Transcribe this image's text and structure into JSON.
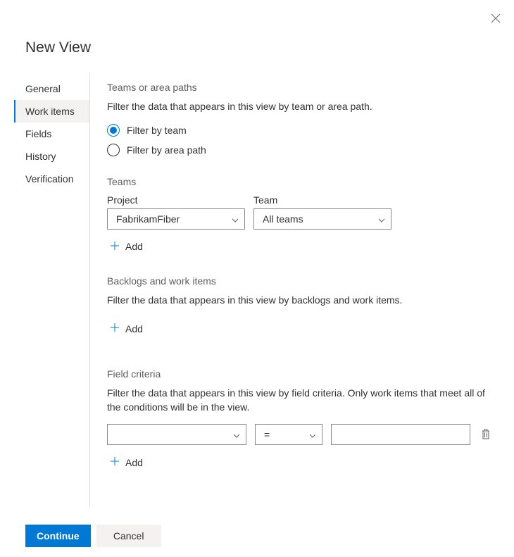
{
  "title": "New View",
  "sidebar": {
    "items": [
      {
        "label": "General"
      },
      {
        "label": "Work items"
      },
      {
        "label": "Fields"
      },
      {
        "label": "History"
      },
      {
        "label": "Verification"
      }
    ],
    "activeIndex": 1
  },
  "sections": {
    "teamsAreaPaths": {
      "heading": "Teams or area paths",
      "desc": "Filter the data that appears in this view by team or area path.",
      "radios": [
        {
          "label": "Filter by team",
          "checked": true
        },
        {
          "label": "Filter by area path",
          "checked": false
        }
      ]
    },
    "teams": {
      "heading": "Teams",
      "projectLabel": "Project",
      "teamLabel": "Team",
      "rows": [
        {
          "project": "FabrikamFiber",
          "team": "All teams"
        }
      ],
      "addLabel": "Add"
    },
    "backlogs": {
      "heading": "Backlogs and work items",
      "desc": "Filter the data that appears in this view by backlogs and work items.",
      "addLabel": "Add"
    },
    "fieldCriteria": {
      "heading": "Field criteria",
      "desc": "Filter the data that appears in this view by field criteria. Only work items that meet all of the conditions will be in the view.",
      "rows": [
        {
          "field": "",
          "operator": "=",
          "value": ""
        }
      ],
      "addLabel": "Add"
    }
  },
  "footer": {
    "primary": "Continue",
    "secondary": "Cancel"
  }
}
